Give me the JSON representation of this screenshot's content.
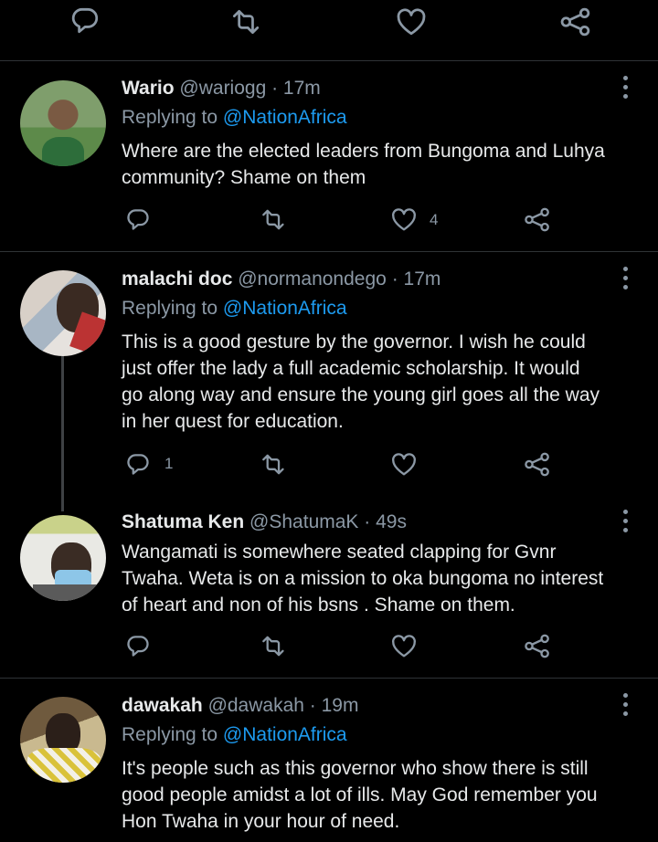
{
  "top_actions": {
    "reply_icon": "reply-icon",
    "retweet_icon": "retweet-icon",
    "like_icon": "like-icon",
    "share_icon": "share-icon"
  },
  "tweets": [
    {
      "name": "Wario",
      "handle": "@wariogg",
      "time": "· 17m",
      "replying_prefix": "Replying to ",
      "replying_to": "@NationAfrica",
      "lines": [
        "Where are the elected leaders from Bungoma and Luhya",
        "community? Shame on them"
      ],
      "reply_count": "",
      "like_count": "4"
    },
    {
      "name": "malachi doc",
      "handle": "@normanondego",
      "time": "· 17m",
      "replying_prefix": "Replying to ",
      "replying_to": "@NationAfrica",
      "lines": [
        "This is a good gesture by the governor. I wish he could",
        "just offer the lady a full academic scholarship.  It would",
        "go along way and ensure the young girl goes all the way",
        "in her quest for education."
      ],
      "reply_count": "1",
      "like_count": ""
    },
    {
      "name": "Shatuma Ken",
      "handle": "@ShatumaK",
      "time": "· 49s",
      "lines": [
        "Wangamati is somewhere seated clapping for Gvnr",
        "Twaha. Weta is on a mission to oka bungoma no interest",
        "of heart and non of his bsns . Shame on them."
      ],
      "reply_count": "",
      "like_count": ""
    },
    {
      "name": "dawakah",
      "handle": "@dawakah",
      "time": "· 19m",
      "replying_prefix": "Replying to ",
      "replying_to": "@NationAfrica",
      "lines": [
        "It's people such as this governor who show there is still",
        "good people amidst a lot of ills. May God remember you",
        "Hon Twaha in your hour of need."
      ]
    }
  ],
  "colors": {
    "background": "#000000",
    "link": "#1d9bf0",
    "muted": "#8b98a5",
    "text": "#e7e9ea"
  }
}
